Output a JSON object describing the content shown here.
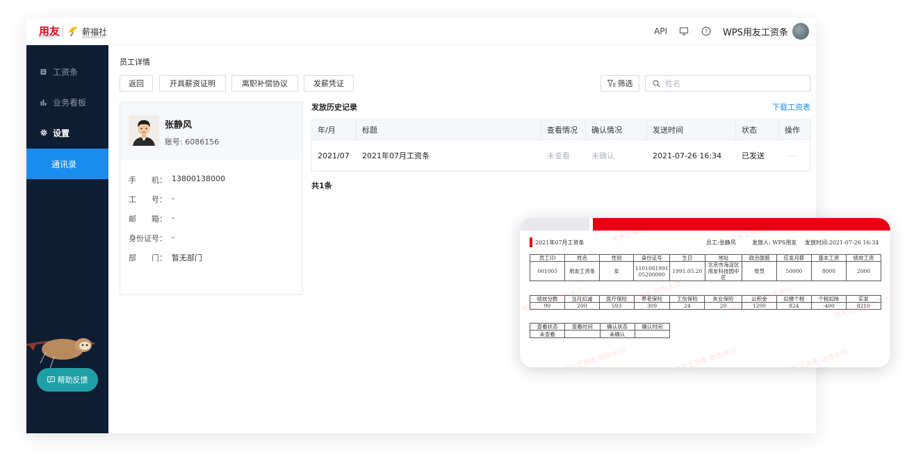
{
  "brand": {
    "yonyou": "用友",
    "yonyou_sub": "yonyou",
    "xinfushe": "薪福社",
    "xinfushe_sub": "xinfushe.com"
  },
  "topbar": {
    "api_label": "API",
    "company_name": "WPS用友工资条"
  },
  "sidebar": {
    "items": [
      {
        "label": "工资条",
        "icon": "payslip-icon"
      },
      {
        "label": "业务看板",
        "icon": "bar-chart-icon"
      },
      {
        "label": "设置",
        "icon": "gear-icon"
      },
      {
        "label": "通讯录",
        "icon": ""
      }
    ],
    "help_label": "帮助反馈"
  },
  "page": {
    "title": "员工详情",
    "buttons": {
      "back": "返回",
      "salary_cert": "开具薪资证明",
      "severance": "离职补偿协议",
      "voucher": "发薪凭证"
    },
    "filter_label": "筛选",
    "search_placeholder": "姓名"
  },
  "employee": {
    "name": "张静风",
    "account": "账号: 6086156",
    "fields": [
      {
        "key": "手　　机：",
        "value": "13800138000"
      },
      {
        "key": "工　　号：",
        "value": "-"
      },
      {
        "key": "邮　　箱：",
        "value": "-"
      },
      {
        "key": "身份证号：",
        "value": "-"
      },
      {
        "key": "部　　门：",
        "value": "暂无部门"
      }
    ]
  },
  "history": {
    "title": "发放历史记录",
    "download_label": "下载工资表",
    "columns": [
      "年/月",
      "标题",
      "查看情况",
      "确认情况",
      "发送时间",
      "状态",
      "操作"
    ],
    "rows": [
      {
        "month": "2021/07",
        "title": "2021年07月工资条",
        "view": "未查看",
        "confirm": "未确认",
        "time": "2021-07-26 16:34",
        "status": "已发送",
        "action": "···"
      }
    ],
    "total": "共1条"
  },
  "payslip": {
    "title": "2021年07月工资条",
    "employee": "员工:张静风",
    "sender": "发放人: WPS用友",
    "send_time": "发放时间:2021-07-26 16:34",
    "watermark": "用友工资条 防伪水印",
    "table1_headers": [
      "员工ID",
      "姓名",
      "性别",
      "身份证号",
      "生日",
      "地址",
      "政治面貌",
      "应发月薪",
      "基本工资",
      "绩效工资"
    ],
    "table1_values": [
      "001005",
      "用友工资条",
      "女",
      "110108199105200000",
      "1991.05.20",
      "北京市海淀区用友科技园中区",
      "党员",
      "50000",
      "8000",
      "2000"
    ],
    "table2_headers": [
      "绩效分数",
      "当月扣减",
      "医疗保险",
      "养老保险",
      "工伤保险",
      "失业保险",
      "公积金",
      "扣缴个税",
      "个税扣除",
      "实发"
    ],
    "table2_values": [
      "90",
      "200",
      "593",
      "309",
      "24",
      "20",
      "1200",
      "824",
      "-400",
      "8210"
    ],
    "table3_headers": [
      "查看状态",
      "查看时间",
      "确认状态",
      "确认时间"
    ],
    "table3_values": [
      "未查看",
      "",
      "未确认",
      ""
    ]
  },
  "colors": {
    "sidebar_bg": "#0f1d33",
    "accent_blue": "#1a8cf0",
    "help_teal": "#1f9ea6",
    "brand_red": "#e60012"
  }
}
